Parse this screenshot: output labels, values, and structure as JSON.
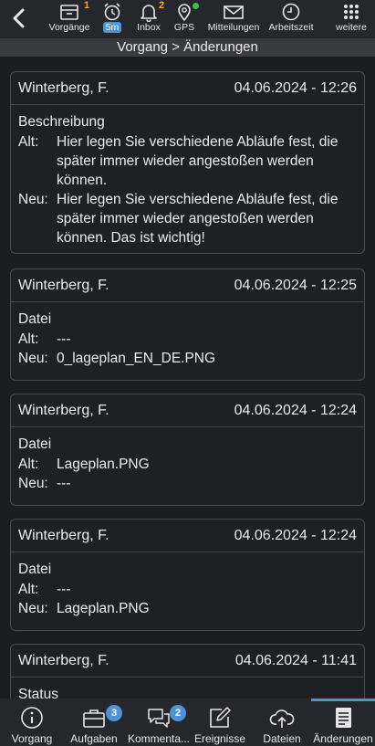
{
  "toolbar": {
    "back_icon": "chevron-left-icon",
    "items": [
      {
        "label": "Vorgänge",
        "icon": "inbox-tray-icon",
        "badge": "1"
      },
      {
        "label": "5m",
        "icon": "alarm-clock-icon"
      },
      {
        "label": "Inbox",
        "icon": "bell-icon",
        "badge": "2"
      },
      {
        "label": "GPS",
        "icon": "location-pin-icon",
        "status_color": "#37c44c"
      },
      {
        "label": "Mitteilungen",
        "icon": "envelope-icon"
      },
      {
        "label": "Arbeitszeit",
        "icon": "clock-icon"
      },
      {
        "label": "weitere",
        "icon": "grid-dots-icon"
      }
    ]
  },
  "title": "Vorgang > Änderungen",
  "cards": [
    {
      "author": "Winterberg, F.",
      "date": "04.06.2024 - 12:26",
      "field": "Beschreibung",
      "alt_label": "Alt:",
      "alt_value": "Hier legen Sie verschiedene Abläufe fest, die später immer wieder angestoßen werden können.",
      "neu_label": "Neu:",
      "neu_value": "Hier legen Sie verschiedene Abläufe fest, die später immer wieder angestoßen werden können. Das ist wichtig!"
    },
    {
      "author": "Winterberg, F.",
      "date": "04.06.2024 - 12:25",
      "field": "Datei",
      "alt_label": "Alt:",
      "alt_value": "---",
      "neu_label": "Neu:",
      "neu_value": "0_lageplan_EN_DE.PNG"
    },
    {
      "author": "Winterberg, F.",
      "date": "04.06.2024 - 12:24",
      "field": "Datei",
      "alt_label": "Alt:",
      "alt_value": "Lageplan.PNG",
      "neu_label": "Neu:",
      "neu_value": "---"
    },
    {
      "author": "Winterberg, F.",
      "date": "04.06.2024 - 12:24",
      "field": "Datei",
      "alt_label": "Alt:",
      "alt_value": "---",
      "neu_label": "Neu:",
      "neu_value": "Lageplan.PNG"
    },
    {
      "author": "Winterberg, F.",
      "date": "04.06.2024 - 11:41",
      "field": "Status"
    }
  ],
  "bottom_nav": {
    "items": [
      {
        "label": "Vorgang",
        "icon": "info-circle-icon"
      },
      {
        "label": "Aufgaben",
        "icon": "briefcase-icon",
        "badge": "3"
      },
      {
        "label": "Kommenta...",
        "icon": "chat-bubbles-icon",
        "badge": "2"
      },
      {
        "label": "Ereignisse",
        "icon": "edit-note-icon"
      },
      {
        "label": "Dateien",
        "icon": "cloud-upload-icon"
      },
      {
        "label": "Änderungen",
        "icon": "document-list-icon",
        "active": "true"
      }
    ]
  },
  "colors": {
    "accent": "#4f93d6",
    "badge_orange": "#ff9f1c",
    "status_green": "#37c44c",
    "background": "#1c1d21"
  }
}
